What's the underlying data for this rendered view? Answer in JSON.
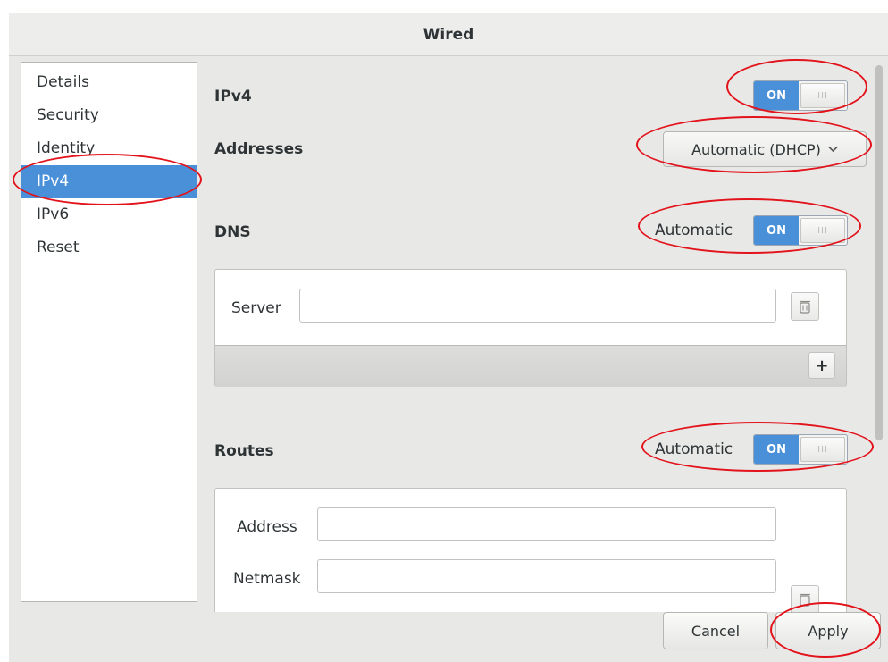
{
  "window": {
    "title": "Wired"
  },
  "sidebar": {
    "items": [
      {
        "label": "Details"
      },
      {
        "label": "Security"
      },
      {
        "label": "Identity"
      },
      {
        "label": "IPv4"
      },
      {
        "label": "IPv6"
      },
      {
        "label": "Reset"
      }
    ],
    "selected": "IPv4"
  },
  "ipv4": {
    "label": "IPv4",
    "switch_on_text": "ON",
    "switch_knob_grip": "III"
  },
  "addresses": {
    "label": "Addresses",
    "selected_value": "Automatic (DHCP)",
    "chevron": "chevron-down-icon"
  },
  "dns": {
    "label": "DNS",
    "automatic_label": "Automatic",
    "switch_on_text": "ON",
    "server_label": "Server",
    "server_value": "",
    "delete_icon": "trash-icon",
    "add_icon": "plus-icon",
    "add_glyph": "+"
  },
  "routes": {
    "label": "Routes",
    "automatic_label": "Automatic",
    "switch_on_text": "ON",
    "address_label": "Address",
    "address_value": "",
    "netmask_label": "Netmask",
    "netmask_value": ""
  },
  "footer": {
    "cancel_label": "Cancel",
    "apply_label": "Apply"
  },
  "colors": {
    "accent": "#4a90d9",
    "annotation": "#e3131b"
  }
}
